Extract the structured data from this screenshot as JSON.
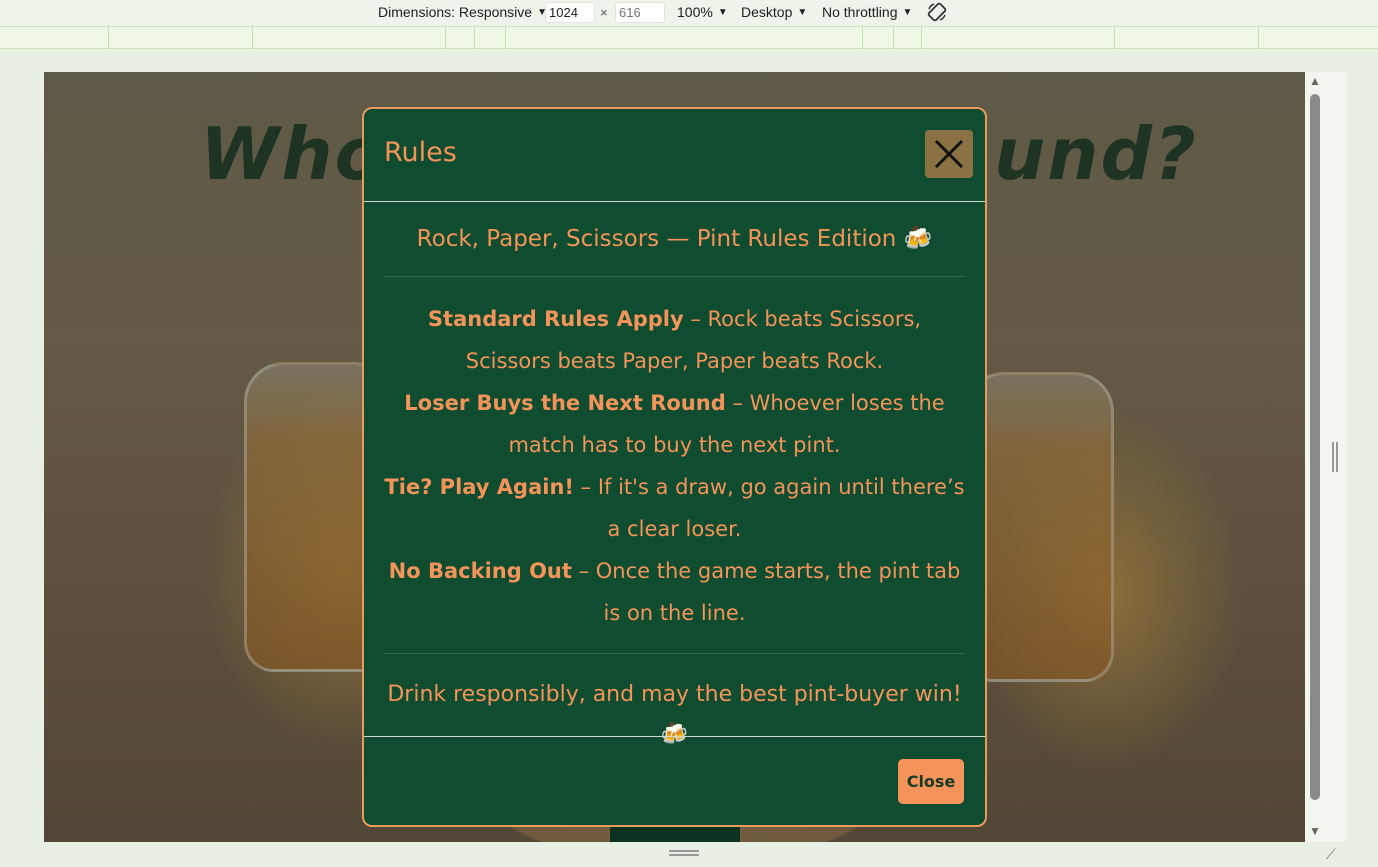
{
  "devtools": {
    "dimensions_label": "Dimensions: Responsive",
    "width_value": "1024",
    "height_placeholder": "616",
    "times": "×",
    "zoom": "100%",
    "device": "Desktop",
    "throttling": "No throttling",
    "rotate_icon": "rotate-icon"
  },
  "page": {
    "heading_left": "Who's",
    "heading_right": "und?"
  },
  "modal": {
    "title": "Rules",
    "close_icon": "close-icon",
    "subtitle": "Rock, Paper, Scissors — Pint Rules Edition",
    "subtitle_emoji": "🍻",
    "rules": [
      {
        "bold": "Standard Rules Apply",
        "text": " – Rock beats Scissors, Scissors beats Paper, Paper beats Rock."
      },
      {
        "bold": "Loser Buys the Next Round",
        "text": " – Whoever loses the match has to buy the next pint."
      },
      {
        "bold": "Tie? Play Again!",
        "text": " – If it's a draw, go again until there’s a clear loser."
      },
      {
        "bold": "No Backing Out",
        "text": " – Once the game starts, the pint tab is on the line."
      }
    ],
    "footer_note": "Drink responsibly, and may the best pint-buyer win!",
    "footer_emoji": "🍻",
    "close_button": "Close"
  },
  "colors": {
    "modal_bg": "#104c2f",
    "accent": "#f4945a",
    "close_x_bg": "#8a7244"
  }
}
